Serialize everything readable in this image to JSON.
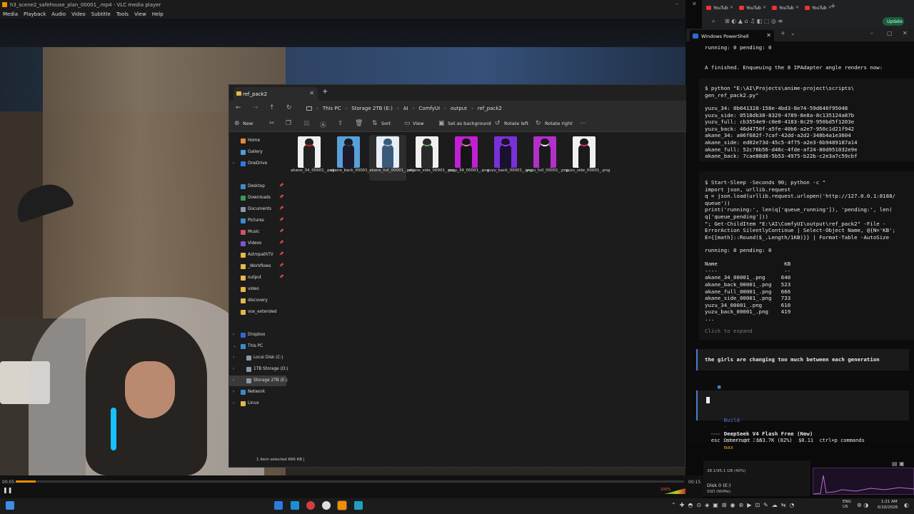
{
  "vlc": {
    "title": "h3_scene2_safehouse_plan_00001_.mp4 - VLC media player",
    "menu": [
      "Media",
      "Playback",
      "Audio",
      "Video",
      "Subtitle",
      "Tools",
      "View",
      "Help"
    ],
    "time_elapsed": "00:05",
    "time_total": "00:15",
    "volume_label": "100%",
    "progress_fraction": 0.03
  },
  "explorer": {
    "tab_title": "ref_pack2",
    "breadcrumbs": [
      "This PC",
      "Storage 2TB (E:)",
      "AI",
      "ComfyUI",
      "output",
      "ref_pack2"
    ],
    "toolbar": {
      "new": "New",
      "sort": "Sort",
      "view": "View",
      "set_background": "Set as background",
      "rotate_left": "Rotate left",
      "rotate_right": "Rotate right"
    },
    "nav": [
      {
        "label": "Home",
        "icon": "home-icon",
        "color": "#e08a3c"
      },
      {
        "label": "Gallery",
        "icon": "gallery-icon",
        "color": "#4aa0e0"
      },
      {
        "label": "OneDrive",
        "icon": "cloud-icon",
        "color": "#2a7be0"
      },
      {
        "label": "Desktop",
        "icon": "desktop-icon",
        "color": "#3a8ad0"
      },
      {
        "label": "Downloads",
        "icon": "download-icon",
        "color": "#3a9a5a"
      },
      {
        "label": "Documents",
        "icon": "document-icon",
        "color": "#8899aa"
      },
      {
        "label": "Pictures",
        "icon": "pictures-icon",
        "color": "#3a8ad0"
      },
      {
        "label": "Music",
        "icon": "music-icon",
        "color": "#d0506a"
      },
      {
        "label": "Videos",
        "icon": "videos-icon",
        "color": "#7a5ad0"
      },
      {
        "label": "AstropathTV",
        "icon": "folder-icon",
        "color": "#e6b84b"
      },
      {
        "label": "_Workflows",
        "icon": "folder-icon",
        "color": "#e6b84b"
      },
      {
        "label": "output",
        "icon": "folder-icon",
        "color": "#e6b84b"
      },
      {
        "label": "video",
        "icon": "folder-icon",
        "color": "#e6b84b"
      },
      {
        "label": "discovery",
        "icon": "folder-icon",
        "color": "#e6b84b"
      },
      {
        "label": "vox_extended",
        "icon": "folder-icon",
        "color": "#e6b84b"
      },
      {
        "label": "Dropbox",
        "icon": "dropbox-icon",
        "color": "#2a6bd1"
      },
      {
        "label": "This PC",
        "icon": "pc-icon",
        "color": "#3a8ad0"
      },
      {
        "label": "Local Disk (C:)",
        "icon": "drive-icon",
        "color": "#8899aa"
      },
      {
        "label": "1TB Storage (D:)",
        "icon": "drive-icon",
        "color": "#8899aa"
      },
      {
        "label": "Storage 2TB (E:)",
        "icon": "drive-icon",
        "color": "#8899aa"
      },
      {
        "label": "Network",
        "icon": "network-icon",
        "color": "#3a8ad0"
      },
      {
        "label": "Linux",
        "icon": "linux-icon",
        "color": "#e6b84b"
      }
    ],
    "files": [
      {
        "name": "akane_34_00001_.png",
        "bg": "#f0f0f0",
        "fig": "#222",
        "accent": "#c22"
      },
      {
        "name": "akane_back_00001_.png",
        "bg": "#5aa0d8",
        "fig": "#1a1a2a",
        "accent": "#333"
      },
      {
        "name": "akane_full_00001_.png",
        "bg": "#e8eef4",
        "fig": "#3a5a7a",
        "accent": "#9ab"
      },
      {
        "name": "akane_side_00001_.png",
        "bg": "#f0f0f0",
        "fig": "#2a2a2a",
        "accent": "#6a6"
      },
      {
        "name": "yuzu_34_00001_.png",
        "bg": "#c020d0",
        "fig": "#151515",
        "accent": "#d8a"
      },
      {
        "name": "yuzu_back_00001_.png",
        "bg": "#7a30d8",
        "fig": "#1a1030",
        "accent": "#a040e0"
      },
      {
        "name": "yuzu_full_00001_.png",
        "bg": "#b030c8",
        "fig": "#1a1a1a",
        "accent": "#fff"
      },
      {
        "name": "yuzu_side_00001_.png",
        "bg": "#f0f0f0",
        "fig": "#1a1a1a",
        "accent": "#d35"
      }
    ],
    "status": "1 item selected  666 KB  |"
  },
  "browser": {
    "tabs": [
      "YouTub",
      "YouTub",
      "YouTub",
      "YouTub"
    ],
    "update_label": "Update"
  },
  "powershell": {
    "tab_title": "Windows PowerShell",
    "lines_top": "running: 0 pending: 0",
    "finished": "A finished. Enqueuing the 8 IPAdapter angle renders now:",
    "cmd1": "$ python \"E:\\AI\\Projects\\anime-project\\scripts\\\ngen_ref_pack2.py\"",
    "ids": "yuzu_34: 0b641328-158e-4bd3-8e74-59d646f95048\nyuzu_side: 0518db38-8329-4789-8e8a-8c135124a87b\nyuzu_full: cb3554e9-c0e0-4183-8c29-950bd5f1203e\nyuzu_back: 46d4750f-a5fe-40b6-a2e7-950c1d21f942\nakane_34: a06f682f-7caf-42dd-a2d2-348b4a1e3604\nakane_side: ed02e73d-45c5-4f75-a2e3-6b9489187a14\nakane_full: 52c76b56-d46c-4fde-af24-80d951032e9e\nakane_back: 7cae88d8-5b53-4975-b22b-c2e3a7c59cbf",
    "cmd2": "$ Start-Sleep -Seconds 90; python -c \"\nimport json, urllib.request\nq = json.load(urllib.request.urlopen('http://127.0.0.1:8188/\nqueue'))\nprint('running:', len(q['queue_running']), 'pending:', len(\nq['queue_pending']))\n\"; Get-ChildItem \"E:\\AI\\ComfyUI\\output\\ref_pack2\" -File -\nErrorAction SilentlyContinue | Select-Object Name, @{N='KB';\nE={[math]::Round($_.Length/1KB)}} | Format-Table -AutoSize",
    "result": "running: 0 pending: 0\n\nName                     KB\n----                     --\nakane_34_00001_.png     640\nakane_back_00001_.png   523\nakane_full_00001_.png   666\nakane_side_00001_.png   733\nyuzu_34_00001_.png      610\nyuzu_back_00001_.png    419\n...",
    "expand": "Click to expand",
    "user_msg": "the girls are changing too much between each generation",
    "build_label": "Build",
    "model": "DeepSeek V4 Flash Free (New)",
    "provider": "OpenCode Zen",
    "mode": "max",
    "status": "esc interrupt  163.7K (82%)  $0.11  ctrl+p commands"
  },
  "system": {
    "gpu": "38.1/95.1 GB (40%)",
    "disk": "Disk 0 (E:)",
    "disk_type": "SSD (NVMe)",
    "lang": "ENG\nUS",
    "time": "1:21 AM",
    "date": "6/10/2026"
  }
}
